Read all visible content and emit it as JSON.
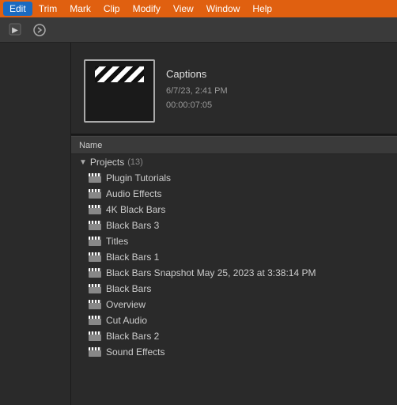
{
  "menubar": {
    "items": [
      {
        "label": "Edit",
        "active": true
      },
      {
        "label": "Trim",
        "active": false
      },
      {
        "label": "Mark",
        "active": false
      },
      {
        "label": "Clip",
        "active": false
      },
      {
        "label": "Modify",
        "active": false
      },
      {
        "label": "View",
        "active": false
      },
      {
        "label": "Window",
        "active": false
      },
      {
        "label": "Help",
        "active": false
      }
    ]
  },
  "preview": {
    "title": "Captions",
    "date": "6/7/23, 2:41 PM",
    "duration": "00:00:07:05"
  },
  "column": {
    "name_label": "Name"
  },
  "projects": {
    "section_label": "Projects",
    "count": "(13)",
    "items": [
      {
        "label": "Plugin Tutorials"
      },
      {
        "label": "Audio Effects"
      },
      {
        "label": "4K Black Bars"
      },
      {
        "label": "Black Bars 3"
      },
      {
        "label": "Titles"
      },
      {
        "label": "Black Bars 1"
      },
      {
        "label": "Black Bars Snapshot May 25, 2023 at 3:38:14 PM"
      },
      {
        "label": "Black Bars"
      },
      {
        "label": "Overview"
      },
      {
        "label": "Cut Audio"
      },
      {
        "label": "Black Bars 2"
      },
      {
        "label": "Sound Effects"
      }
    ]
  }
}
